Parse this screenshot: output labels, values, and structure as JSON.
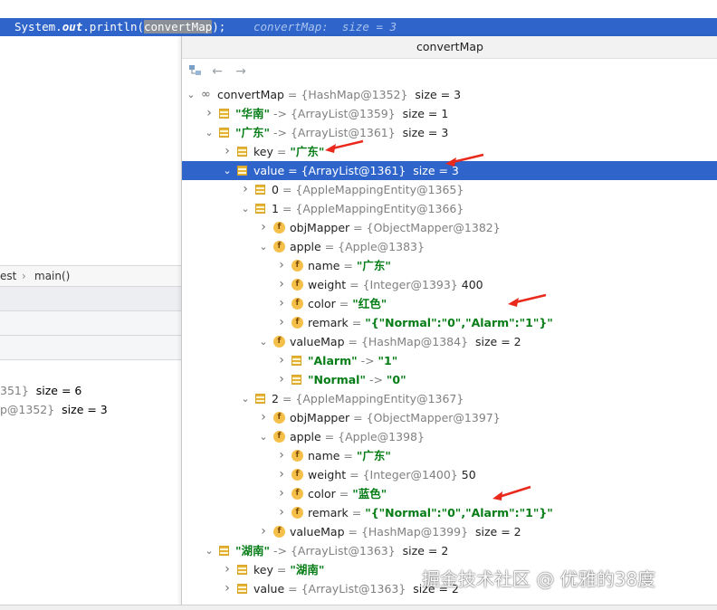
{
  "editor": {
    "code_prefix": "System.",
    "code_out": "out",
    "code_mid": ".println(",
    "code_arg": "convertMap",
    "code_end": ");",
    "inlay_hint": "convertMap:  size = 3",
    "breadcrumb": [
      "est",
      "main()"
    ],
    "bg_vars": [
      {
        "a": "351}",
        "b": "  size = 6"
      },
      {
        "a": "p@1352}",
        "b": "  size = 3"
      }
    ]
  },
  "popup": {
    "title": "convertMap",
    "toolbar": [
      "layout-icon",
      "back-arrow-icon",
      "forward-arrow-icon"
    ]
  },
  "tree": [
    {
      "indent": 0,
      "arrow": "down",
      "icon": "oo",
      "name": "convertMap",
      "eq": " = ",
      "val": "{HashMap@1352}",
      "extra": "  size = 3"
    },
    {
      "indent": 1,
      "arrow": "right",
      "icon": "entry",
      "name": "\"华南\"",
      "kind": "str",
      "eq": " -> ",
      "val": "{ArrayList@1359}",
      "extra": "  size = 1"
    },
    {
      "indent": 1,
      "arrow": "down",
      "icon": "entry",
      "name": "\"广东\"",
      "kind": "str",
      "eq": " -> ",
      "val": "{ArrayList@1361}",
      "extra": "  size = 3"
    },
    {
      "indent": 2,
      "arrow": "right",
      "icon": "entry",
      "name": "key",
      "eq": " = ",
      "val": "\"广东\"",
      "valkind": "str"
    },
    {
      "indent": 2,
      "arrow": "down",
      "icon": "entry",
      "name": "value",
      "eq": " = ",
      "val": "{ArrayList@1361}",
      "extra": "  size = 3",
      "selected": true
    },
    {
      "indent": 3,
      "arrow": "right",
      "icon": "entry",
      "name": "0",
      "eq": " = ",
      "val": "{AppleMappingEntity@1365}"
    },
    {
      "indent": 3,
      "arrow": "down",
      "icon": "entry",
      "name": "1",
      "eq": " = ",
      "val": "{AppleMappingEntity@1366}"
    },
    {
      "indent": 4,
      "arrow": "right",
      "icon": "f",
      "name": "objMapper",
      "eq": " = ",
      "val": "{ObjectMapper@1382}"
    },
    {
      "indent": 4,
      "arrow": "down",
      "icon": "f",
      "name": "apple",
      "eq": " = ",
      "val": "{Apple@1383}"
    },
    {
      "indent": 5,
      "arrow": "right",
      "icon": "f",
      "name": "name",
      "eq": " = ",
      "val": "\"广东\"",
      "valkind": "str"
    },
    {
      "indent": 5,
      "arrow": "right",
      "icon": "f",
      "name": "weight",
      "eq": " = ",
      "val": "{Integer@1393}",
      "extra": " 400"
    },
    {
      "indent": 5,
      "arrow": "right",
      "icon": "f",
      "name": "color",
      "eq": " = ",
      "val": "\"红色\"",
      "valkind": "str"
    },
    {
      "indent": 5,
      "arrow": "right",
      "icon": "f",
      "name": "remark",
      "eq": " = ",
      "val": "\"{\"Normal\":\"0\",\"Alarm\":\"1\"}\"",
      "valkind": "str"
    },
    {
      "indent": 4,
      "arrow": "down",
      "icon": "f",
      "name": "valueMap",
      "eq": " = ",
      "val": "{HashMap@1384}",
      "extra": "  size = 2"
    },
    {
      "indent": 5,
      "arrow": "right",
      "icon": "entry",
      "name": "\"Alarm\"",
      "kind": "str",
      "eq": " -> ",
      "val": "\"1\"",
      "valkind": "str"
    },
    {
      "indent": 5,
      "arrow": "right",
      "icon": "entry",
      "name": "\"Normal\"",
      "kind": "str",
      "eq": " -> ",
      "val": "\"0\"",
      "valkind": "str"
    },
    {
      "indent": 3,
      "arrow": "down",
      "icon": "entry",
      "name": "2",
      "eq": " = ",
      "val": "{AppleMappingEntity@1367}"
    },
    {
      "indent": 4,
      "arrow": "right",
      "icon": "f",
      "name": "objMapper",
      "eq": " = ",
      "val": "{ObjectMapper@1397}"
    },
    {
      "indent": 4,
      "arrow": "down",
      "icon": "f",
      "name": "apple",
      "eq": " = ",
      "val": "{Apple@1398}"
    },
    {
      "indent": 5,
      "arrow": "right",
      "icon": "f",
      "name": "name",
      "eq": " = ",
      "val": "\"广东\"",
      "valkind": "str"
    },
    {
      "indent": 5,
      "arrow": "right",
      "icon": "f",
      "name": "weight",
      "eq": " = ",
      "val": "{Integer@1400}",
      "extra": " 50"
    },
    {
      "indent": 5,
      "arrow": "right",
      "icon": "f",
      "name": "color",
      "eq": " = ",
      "val": "\"蓝色\"",
      "valkind": "str"
    },
    {
      "indent": 5,
      "arrow": "right",
      "icon": "f",
      "name": "remark",
      "eq": " = ",
      "val": "\"{\"Normal\":\"0\",\"Alarm\":\"1\"}\"",
      "valkind": "str"
    },
    {
      "indent": 4,
      "arrow": "right",
      "icon": "f",
      "name": "valueMap",
      "eq": " = ",
      "val": "{HashMap@1399}",
      "extra": "  size = 2"
    },
    {
      "indent": 1,
      "arrow": "down",
      "icon": "entry",
      "name": "\"湖南\"",
      "kind": "str",
      "eq": " -> ",
      "val": "{ArrayList@1363}",
      "extra": "  size = 2"
    },
    {
      "indent": 2,
      "arrow": "right",
      "icon": "entry",
      "name": "key",
      "eq": " = ",
      "val": "\"湖南\"",
      "valkind": "str"
    },
    {
      "indent": 2,
      "arrow": "right",
      "icon": "entry",
      "name": "value",
      "eq": " = ",
      "val": "{ArrayList@1363}",
      "extra": "  size = 2"
    }
  ],
  "annotations": {
    "arrow_color": "#e8291c"
  },
  "watermark": "掘金技术社区 @ 优雅的38度"
}
